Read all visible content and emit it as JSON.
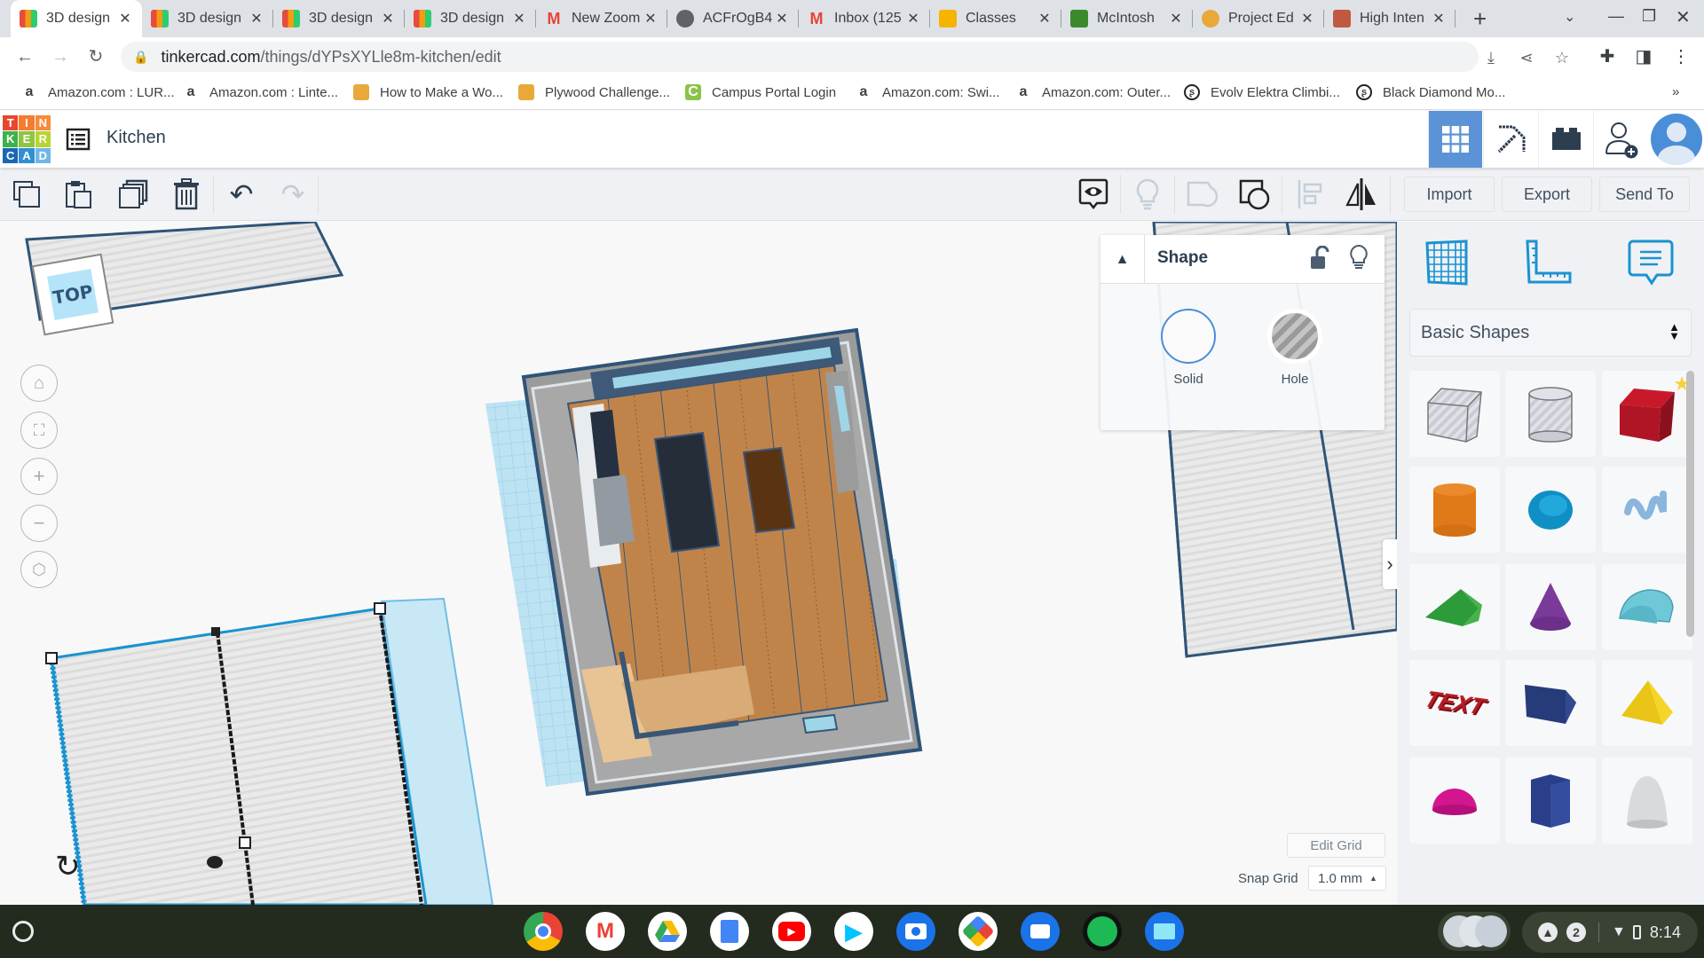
{
  "browser": {
    "tabs": [
      {
        "title": "3D design",
        "icon": "tinkercad-icon",
        "active": true
      },
      {
        "title": "3D design",
        "icon": "tinkercad-icon"
      },
      {
        "title": "3D design",
        "icon": "tinkercad-icon"
      },
      {
        "title": "3D design",
        "icon": "tinkercad-icon"
      },
      {
        "title": "New Zoom",
        "icon": "gmail-icon"
      },
      {
        "title": "ACFrOgB4",
        "icon": "globe-icon"
      },
      {
        "title": "Inbox (125",
        "icon": "gmail-icon"
      },
      {
        "title": "Classes",
        "icon": "classroom-icon"
      },
      {
        "title": "McIntosh",
        "icon": "app-icon"
      },
      {
        "title": "Project Ed",
        "icon": "robot-icon"
      },
      {
        "title": "High Inten",
        "icon": "image-icon"
      }
    ],
    "new_tab": "+",
    "url_host": "tinkercad.com",
    "url_path": "/things/dYPsXYLle8m-kitchen/edit",
    "bookmarks": [
      {
        "label": "Amazon.com : LUR...",
        "icon": "a"
      },
      {
        "label": "Amazon.com : Linte...",
        "icon": "a"
      },
      {
        "label": "How to Make a Wo...",
        "icon": "robot"
      },
      {
        "label": "Plywood Challenge...",
        "icon": "robot"
      },
      {
        "label": "Campus Portal Login",
        "icon": "C"
      },
      {
        "label": "Amazon.com: Swi...",
        "icon": "a"
      },
      {
        "label": "Amazon.com: Outer...",
        "icon": "a"
      },
      {
        "label": "Evolv Elektra Climbi...",
        "icon": "evolv"
      },
      {
        "label": "Black Diamond Mo...",
        "icon": "evolv"
      }
    ],
    "bookmarks_overflow": "»"
  },
  "app": {
    "logo_letters": [
      "T",
      "I",
      "N",
      "K",
      "E",
      "R",
      "C",
      "A",
      "D"
    ],
    "design_title": "Kitchen",
    "toolbar": {
      "import_label": "Import",
      "export_label": "Export",
      "sendto_label": "Send To"
    },
    "viewcube_label": "TOP",
    "inspector": {
      "title": "Shape",
      "solid_label": "Solid",
      "hole_label": "Hole"
    },
    "library": {
      "selected": "Basic Shapes",
      "shapes": [
        "Box Hole",
        "Cylinder Hole",
        "Box",
        "Cylinder",
        "Sphere",
        "Scribble",
        "Roof",
        "Cone",
        "Round Roof",
        "Text",
        "Wedge",
        "Pyramid",
        "Half Sphere",
        "Polygon",
        "Paraboloid"
      ]
    },
    "grid": {
      "edit_label": "Edit Grid",
      "snap_label": "Snap Grid",
      "snap_value": "1.0 mm"
    }
  },
  "os": {
    "tray_badge": "2",
    "time": "8:14"
  },
  "colors": {
    "accent": "#4b8ed8",
    "tinker_blue": "#1a93d0"
  }
}
